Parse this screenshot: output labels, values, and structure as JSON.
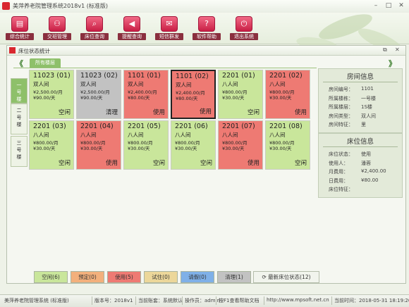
{
  "window": {
    "title": "美萍养老院管理系统2018v1 (标准版)"
  },
  "toolbar": [
    {
      "label": "综合统计",
      "icon": "statistics-icon",
      "glyph": "▤"
    },
    {
      "label": "交班管理",
      "icon": "handover-icon",
      "glyph": "⚇"
    },
    {
      "label": "床位查询",
      "icon": "bed-search-icon",
      "glyph": "⌕"
    },
    {
      "label": "提醒查询",
      "icon": "reminder-icon",
      "glyph": "◀"
    },
    {
      "label": "短信群发",
      "icon": "sms-icon",
      "glyph": "✉"
    },
    {
      "label": "软件帮助",
      "icon": "help-icon",
      "glyph": "?"
    },
    {
      "label": "退出系统",
      "icon": "exit-icon",
      "glyph": "⏻"
    }
  ],
  "child": {
    "title": "床位状态统计",
    "tab": "所有楼层",
    "prev": "《",
    "next": "》"
  },
  "floors": [
    "一号楼",
    "二号楼",
    "三号楼"
  ],
  "rooms": [
    {
      "no": "11023 (01)",
      "type": "双人间",
      "p1": "¥2,500.00/月",
      "p2": "¥90.00/天",
      "status": "空闲",
      "state": "free"
    },
    {
      "no": "11023 (02)",
      "type": "双人间",
      "p1": "¥2,500.00/月",
      "p2": "¥90.00/天",
      "status": "清理",
      "state": "clean"
    },
    {
      "no": "1101 (01)",
      "type": "双人间",
      "p1": "¥2,400.00/月",
      "p2": "¥80.00/天",
      "status": "使用",
      "state": "used"
    },
    {
      "no": "1101 (02)",
      "type": "双人间",
      "p1": "¥2,400.00/月",
      "p2": "¥80.00/天",
      "status": "使用",
      "state": "used",
      "selected": true
    },
    {
      "no": "2201 (01)",
      "type": "八人间",
      "p1": "¥800.00/月",
      "p2": "¥30.00/天",
      "status": "空闲",
      "state": "free"
    },
    {
      "no": "2201 (02)",
      "type": "八人间",
      "p1": "¥800.00/月",
      "p2": "¥30.00/天",
      "status": "使用",
      "state": "used"
    },
    {
      "no": "2201 (03)",
      "type": "八人间",
      "p1": "¥800.00/月",
      "p2": "¥30.00/天",
      "status": "空闲",
      "state": "free"
    },
    {
      "no": "2201 (04)",
      "type": "八人间",
      "p1": "¥800.00/月",
      "p2": "¥30.00/天",
      "status": "使用",
      "state": "used"
    },
    {
      "no": "2201 (05)",
      "type": "八人间",
      "p1": "¥800.00/月",
      "p2": "¥30.00/天",
      "status": "空闲",
      "state": "free"
    },
    {
      "no": "2201 (06)",
      "type": "八人间",
      "p1": "¥800.00/月",
      "p2": "¥30.00/天",
      "status": "空闲",
      "state": "free"
    },
    {
      "no": "2201 (07)",
      "type": "八人间",
      "p1": "¥800.00/月",
      "p2": "¥30.00/天",
      "status": "使用",
      "state": "used"
    },
    {
      "no": "2201 (08)",
      "type": "八人间",
      "p1": "¥800.00/月",
      "p2": "¥30.00/天",
      "status": "空闲",
      "state": "free"
    }
  ],
  "room_info": {
    "title": "房间信息",
    "rows": [
      {
        "label": "房间编号：",
        "value": "1101"
      },
      {
        "label": "所属楼栋：",
        "value": "一号楼"
      },
      {
        "label": "所属楼层：",
        "value": "1S楼"
      },
      {
        "label": "房间类型：",
        "value": "双人间"
      },
      {
        "label": "房间特征：",
        "value": "里"
      }
    ]
  },
  "bed_info": {
    "title": "床位信息",
    "rows": [
      {
        "label": "床位状态：",
        "value": "使用"
      },
      {
        "label": "使用人：",
        "value": "潘蓉"
      },
      {
        "label": "月费用：",
        "value": "¥2,400.00"
      },
      {
        "label": "日费用：",
        "value": "¥80.00"
      },
      {
        "label": "床位特征：",
        "value": ""
      }
    ]
  },
  "legend": [
    {
      "label": "空闲(6)",
      "color": "#c9e69b"
    },
    {
      "label": "预定(0)",
      "color": "#f3b07c"
    },
    {
      "label": "使用(5)",
      "color": "#ee7a73"
    },
    {
      "label": "试住(0)",
      "color": "#ecd79a"
    },
    {
      "label": "请假(0)",
      "color": "#7fb0e8"
    },
    {
      "label": "清理(1)",
      "color": "#c2c2c2"
    }
  ],
  "refresh_label": "最新床位状态(12)",
  "statusbar": [
    "美萍养老院管理系统 (标准版)",
    "版本号：2018v1",
    "当前账套：系统默认",
    "操作员：admin",
    "按F1查看帮助文档",
    "http://www.mpsoft.net.cn",
    "当前时间：2018-05-31 18:19:20"
  ]
}
